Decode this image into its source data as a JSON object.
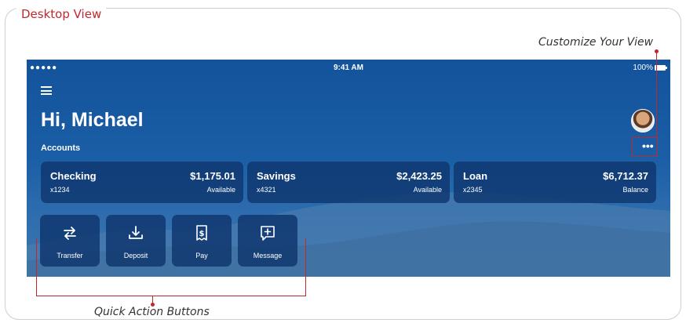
{
  "frame": {
    "title": "Desktop View"
  },
  "callouts": {
    "customize": "Customize Your View",
    "quick_actions": "Quick Action Buttons"
  },
  "status_bar": {
    "signal": "●●●●● ",
    "time": "9:41 AM",
    "battery": "100%"
  },
  "header": {
    "greeting": "Hi, Michael",
    "accounts_label": "Accounts",
    "more": "•••"
  },
  "accounts": [
    {
      "name": "Checking",
      "number": "x1234",
      "amount": "$1,175.01",
      "status": "Available"
    },
    {
      "name": "Savings",
      "number": "x4321",
      "amount": "$2,423.25",
      "status": "Available"
    },
    {
      "name": "Loan",
      "number": "x2345",
      "amount": "$6,712.37",
      "status": "Balance"
    }
  ],
  "quick_actions": [
    {
      "label": "Transfer",
      "icon": "transfer-icon"
    },
    {
      "label": "Deposit",
      "icon": "deposit-icon"
    },
    {
      "label": "Pay",
      "icon": "pay-icon"
    },
    {
      "label": "Message",
      "icon": "message-icon"
    }
  ],
  "colors": {
    "accent_red": "#c2272d",
    "background_blue": "#1a5ea6",
    "card_blue": "#0f376e"
  }
}
